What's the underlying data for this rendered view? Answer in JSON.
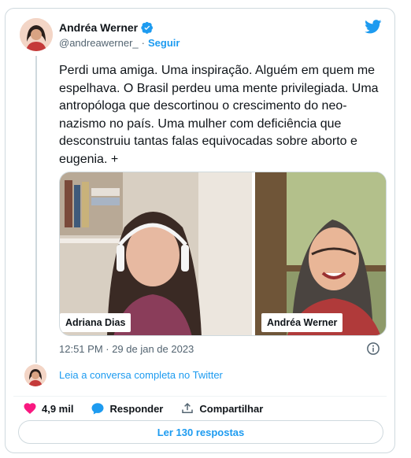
{
  "author": {
    "name": "Andréa Werner",
    "handle": "@andreawerner_",
    "separator": "·",
    "follow_label": "Seguir"
  },
  "tweet": {
    "text": "Perdi uma amiga. Uma inspiração. Alguém em quem me espelhava. O Brasil perdeu uma mente privilegiada. Uma antropóloga que descortinou o crescimento do neo-nazismo no país. Uma mulher com deficiência que desconstruiu tantas falas equivocadas sobre aborto e eugenia. +",
    "timestamp": "12:51 PM · 29 de jan de 2023"
  },
  "media": {
    "left_label": "Adriana Dias",
    "right_label": "Andréa Werner"
  },
  "conversation_link": "Leia a conversa completa no Twitter",
  "actions": {
    "likes": "4,9 mil",
    "reply_label": "Responder",
    "share_label": "Compartilhar"
  },
  "replies_button": "Ler 130 respostas",
  "colors": {
    "accent": "#1d9bf0",
    "like": "#f91880",
    "muted": "#536471"
  }
}
